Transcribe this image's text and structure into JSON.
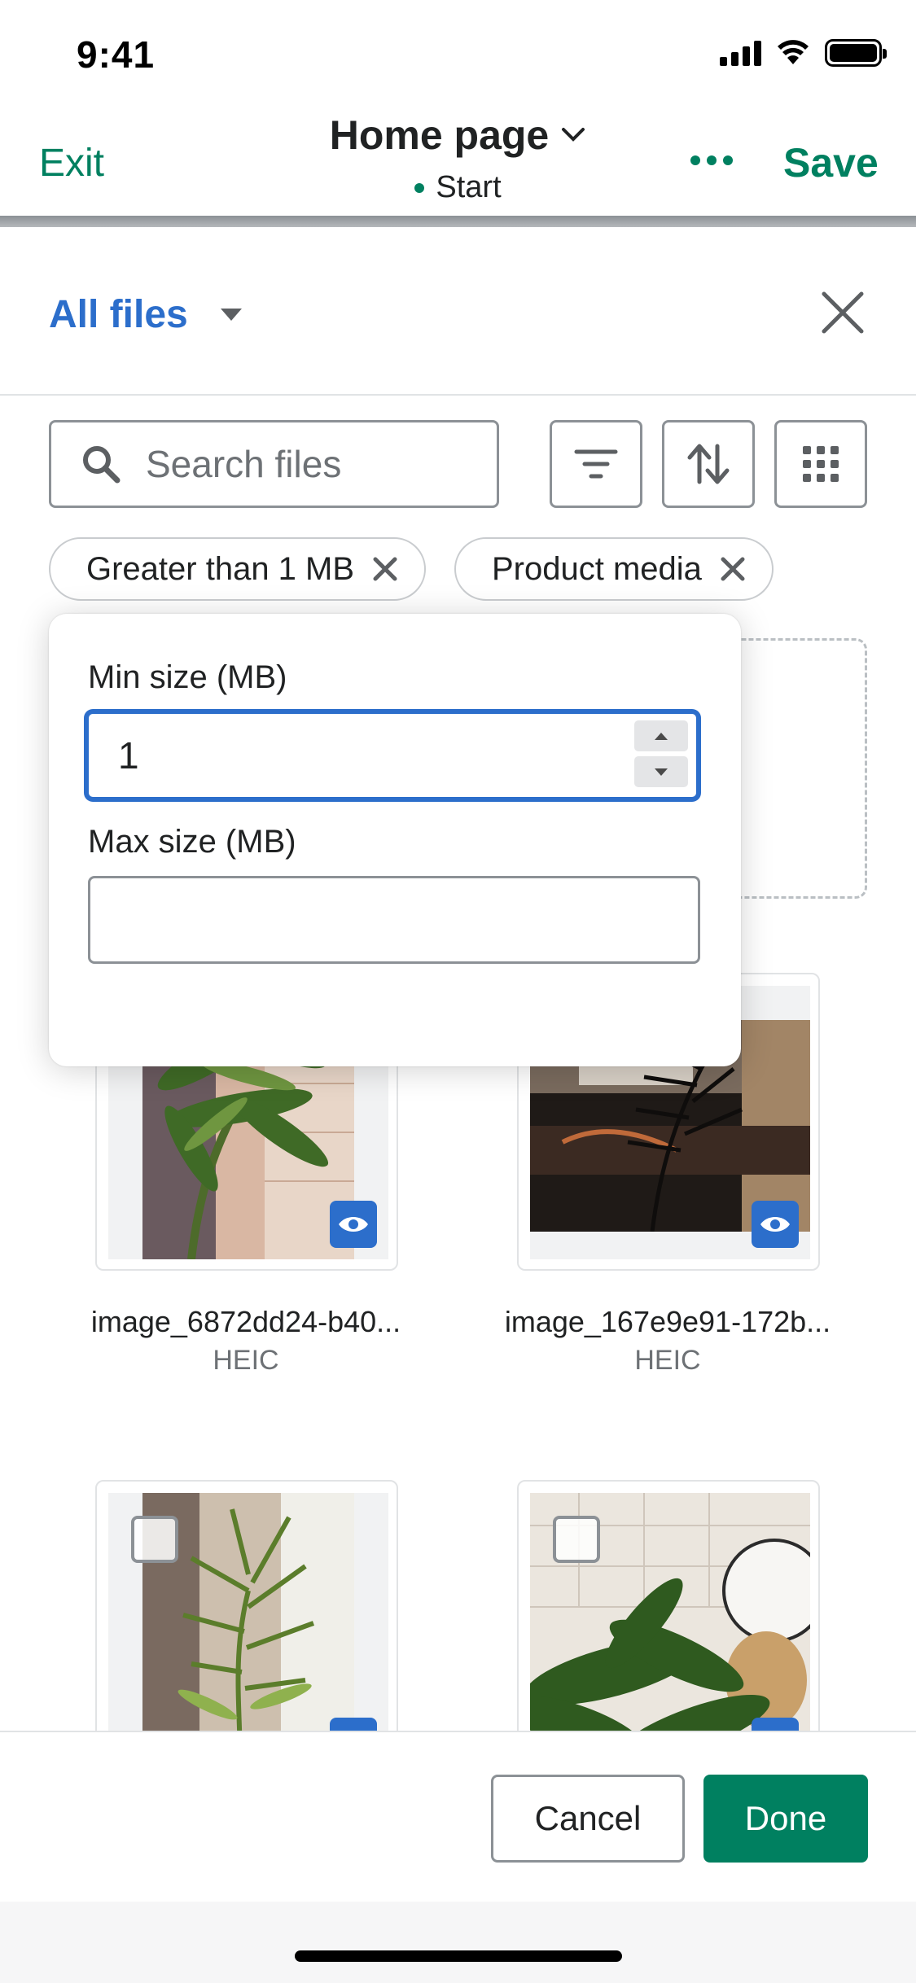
{
  "status_bar": {
    "time": "9:41"
  },
  "header": {
    "exit_label": "Exit",
    "page_title": "Home page",
    "page_subtitle": "Start",
    "save_label": "Save"
  },
  "files_panel": {
    "title": "All files",
    "search": {
      "placeholder": "Search files",
      "value": ""
    },
    "filters": [
      {
        "label": "Greater than 1 MB"
      },
      {
        "label": "Product media"
      }
    ],
    "size_popover": {
      "min_label": "Min size (MB)",
      "min_value": "1",
      "max_label": "Max size (MB)",
      "max_value": ""
    },
    "files": [
      {
        "name": "image_6872dd24-b40...",
        "type": "HEIC"
      },
      {
        "name": "image_167e9e91-172b...",
        "type": "HEIC"
      },
      {
        "name": "",
        "type": ""
      },
      {
        "name": "",
        "type": ""
      }
    ]
  },
  "footer": {
    "cancel_label": "Cancel",
    "done_label": "Done"
  },
  "colors": {
    "accent_green": "#008060",
    "link_blue": "#2c6ecb",
    "border_gray": "#8c9196"
  }
}
